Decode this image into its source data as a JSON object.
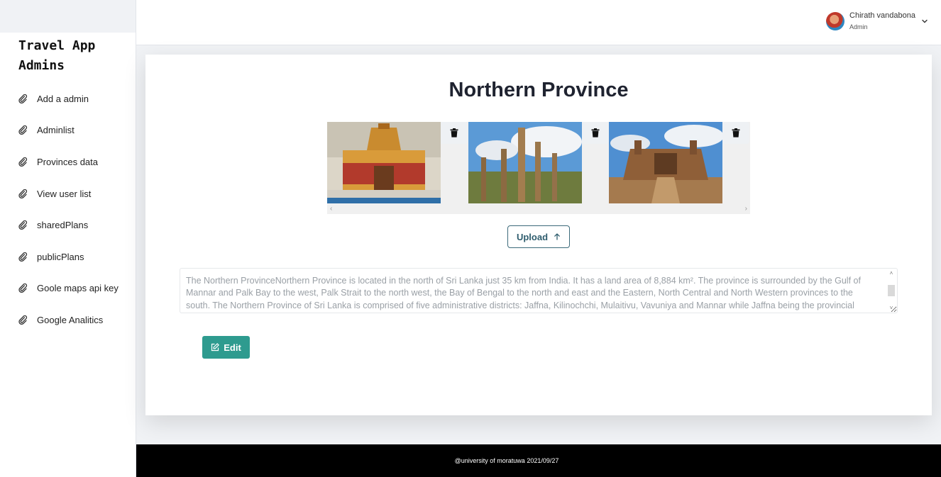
{
  "sidebar": {
    "brand_line1": "Travel App",
    "brand_line2": "Admins",
    "items": [
      {
        "label": "Add a admin",
        "icon": "link-icon"
      },
      {
        "label": "Adminlist",
        "icon": "link-icon"
      },
      {
        "label": "Provinces data",
        "icon": "link-icon"
      },
      {
        "label": "View user list",
        "icon": "link-icon"
      },
      {
        "label": "sharedPlans",
        "icon": "link-icon"
      },
      {
        "label": "publicPlans",
        "icon": "link-icon"
      },
      {
        "label": "Goole maps api key",
        "icon": "link-icon"
      },
      {
        "label": "Google Analitics",
        "icon": "link-icon"
      }
    ]
  },
  "header": {
    "user_name": "Chirath vandabona",
    "user_role": "Admin"
  },
  "main": {
    "title": "Northern Province",
    "images": [
      {
        "icon": "trash-icon"
      },
      {
        "icon": "trash-icon"
      },
      {
        "icon": "trash-icon"
      }
    ],
    "upload_label": "Upload",
    "description": "The Northern ProvinceNorthern Province is located in the north of Sri Lanka just 35 km from India. It has a land area of 8,884 km². The province is surrounded by the Gulf of Mannar and Palk Bay to the west, Palk Strait to the north west, the Bay of Bengal to the north and east and the Eastern, North Central and North Western provinces to the south. The Northern Province of Sri Lanka is comprised of five administrative districts: Jaffna, Kilinochchi, Mulaitivu, Vavuniya and Mannar while Jaffna being the provincial capital.",
    "edit_label": "Edit"
  },
  "footer": {
    "text": "@university of moratuwa 2021/09/27"
  },
  "colors": {
    "accent": "#2e9b8f",
    "upload_border": "#3c6a7a",
    "footer_bg": "#000000"
  }
}
